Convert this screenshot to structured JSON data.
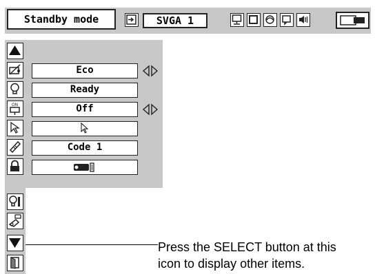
{
  "toolbar": {
    "mode_label": "Standby mode",
    "signal_label": "SVGA 1",
    "icons": [
      "input-icon",
      "image-adjust-icon",
      "screen-icon",
      "color-icon",
      "picture-icon",
      "sound-icon",
      "setting-icon"
    ]
  },
  "menu": {
    "side_icons": [
      "scroll-up-icon",
      "power-management-icon",
      "lamp-icon",
      "on-start-icon",
      "pointer-icon",
      "remote-control-icon",
      "security-lock-icon",
      "lamp-reset-icon",
      "filter-counter-icon",
      "scroll-down-icon",
      "exit-icon"
    ],
    "items": [
      {
        "value": "Eco",
        "has_arrows": true
      },
      {
        "value": "Ready",
        "has_arrows": false
      },
      {
        "value": "Off",
        "has_arrows": true
      },
      {
        "value": "",
        "has_arrows": false
      },
      {
        "value": "Code 1",
        "has_arrows": false
      },
      {
        "value": "",
        "has_arrows": false
      }
    ]
  },
  "note": {
    "line1": "Press the SELECT button at this",
    "line2": "icon to display other items."
  }
}
